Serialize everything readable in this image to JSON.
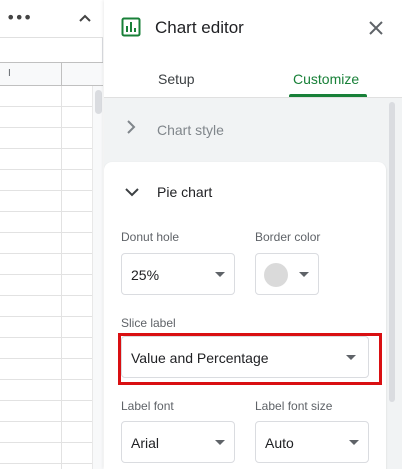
{
  "sheet": {
    "more_icon": "more-horizontal-icon",
    "collapse_icon": "chevron-up-icon",
    "column_letter": "I"
  },
  "editor": {
    "title": "Chart editor",
    "title_icon": "chart-icon",
    "close_icon": "close-icon",
    "tabs": [
      {
        "label": "Setup",
        "active": false
      },
      {
        "label": "Customize",
        "active": true
      }
    ],
    "accent_color": "#188038"
  },
  "chart_style": {
    "label": "Chart style",
    "expanded": false
  },
  "pie_chart": {
    "label": "Pie chart",
    "expanded": true,
    "donut_hole": {
      "label": "Donut hole",
      "value": "25%"
    },
    "border_color": {
      "label": "Border color",
      "swatch_color": "#dadada"
    },
    "slice_label": {
      "label": "Slice label",
      "value": "Value and Percentage",
      "highlight_color": "#d90f12"
    },
    "label_font": {
      "label": "Label font",
      "value": "Arial"
    },
    "label_font_size": {
      "label": "Label font size",
      "value": "Auto"
    }
  }
}
